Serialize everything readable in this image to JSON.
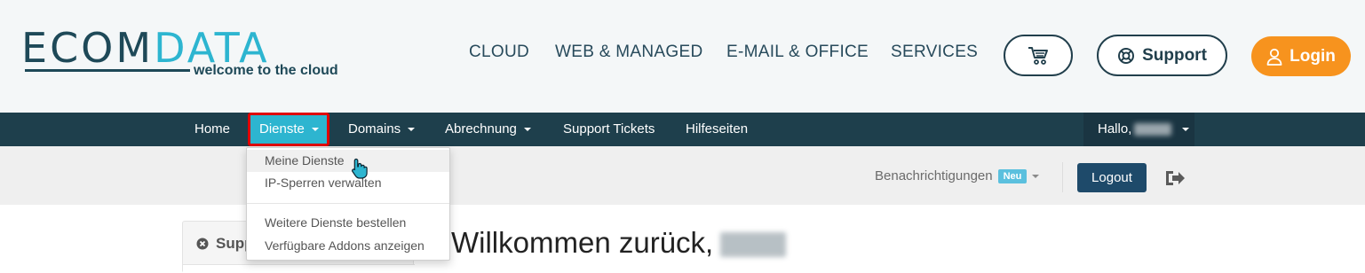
{
  "logo": {
    "word_dark": "ECOM",
    "word_blue": "DATA",
    "tagline": "welcome to the cloud"
  },
  "top_nav": [
    "CLOUD",
    "WEB & MANAGED",
    "E-MAIL & OFFICE",
    "SERVICES"
  ],
  "header_buttons": {
    "cart_icon": "cart-icon",
    "support": "Support",
    "support_icon": "lifebuoy-icon",
    "login": "Login",
    "login_icon": "user-icon"
  },
  "navbar": {
    "home": "Home",
    "dienste": "Dienste",
    "domains": "Domains",
    "abrechnung": "Abrechnung",
    "support_tickets": "Support Tickets",
    "hilfeseiten": "Hilfeseiten",
    "hello": "Hallo,"
  },
  "dropdown": {
    "items": [
      "Meine Dienste",
      "IP-Sperren verwalten",
      "Weitere Dienste bestellen",
      "Verfügbare Addons anzeigen"
    ],
    "hovered": "Meine Dienste"
  },
  "subbar": {
    "notifications": "Benachrichtigungen",
    "badge": "Neu",
    "logout": "Logout",
    "exit_icon": "sign-out-icon"
  },
  "main": {
    "side_title": "Supp",
    "side_icon": "close-circle-icon",
    "welcome": "Willkommen zurück,"
  },
  "colors": {
    "brand_dark": "#1e3f4c",
    "brand_blue": "#2db5d0",
    "login_orange": "#f7931e",
    "highlight_red": "#e00000"
  }
}
